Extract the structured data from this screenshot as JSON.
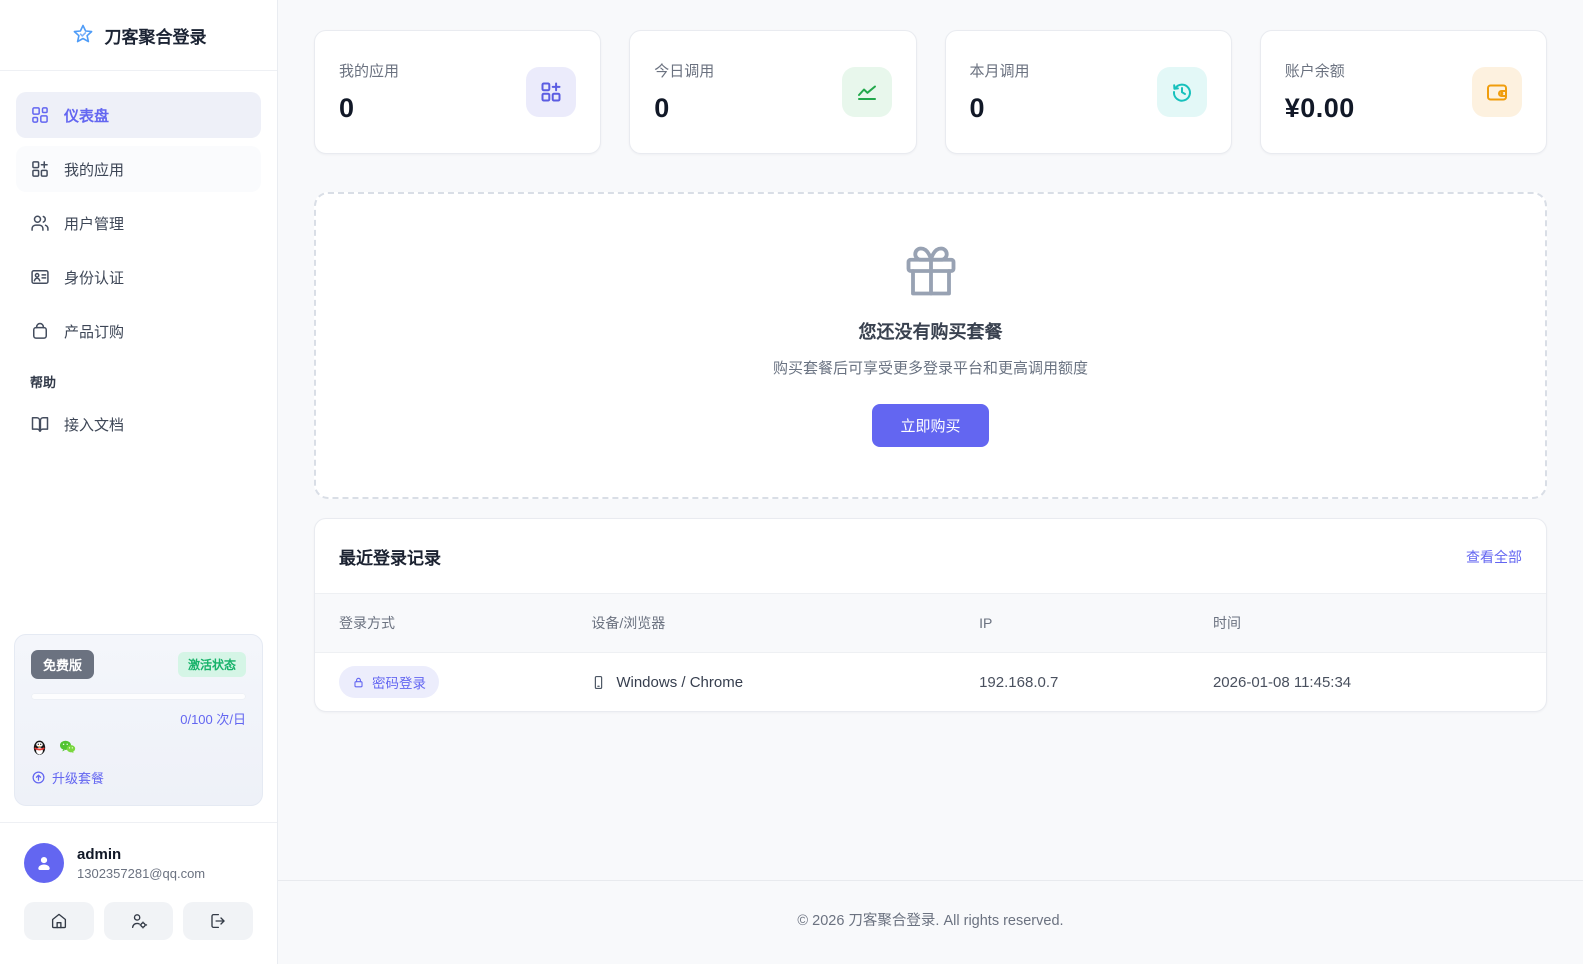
{
  "app": {
    "name": "刀客聚合登录",
    "footer": "© 2026 刀客聚合登录. All rights reserved."
  },
  "colors": {
    "accent": "#6366f1",
    "success": "#17b26a",
    "teal": "#17c1bc",
    "orange": "#f09d0c",
    "main_bg": "#f8f9fb"
  },
  "sidebar": {
    "items": [
      {
        "label": "仪表盘",
        "icon": "dashboard-grid-icon",
        "active": true
      },
      {
        "label": "我的应用",
        "icon": "grid-plus-icon"
      },
      {
        "label": "用户管理",
        "icon": "users-icon"
      },
      {
        "label": "身份认证",
        "icon": "id-card-icon"
      },
      {
        "label": "产品订购",
        "icon": "shopping-bag-icon"
      }
    ],
    "help_section": "帮助",
    "docs_item": {
      "label": "接入文档",
      "icon": "book-icon"
    },
    "plan": {
      "name": "免费版",
      "status": "激活状态",
      "quota": "0/100 次/日",
      "upgrade": "升级套餐",
      "platform_icons": [
        "qq-icon",
        "wechat-icon"
      ]
    },
    "user": {
      "name": "admin",
      "email": "1302357281@qq.com"
    }
  },
  "stats": [
    {
      "label": "我的应用",
      "value": "0",
      "icon": "grid-plus-icon",
      "color": "#5b5ce2",
      "bg": "#ebebfb"
    },
    {
      "label": "今日调用",
      "value": "0",
      "icon": "trend-chart-icon",
      "color": "#23a84c",
      "bg": "#e8f7ec"
    },
    {
      "label": "本月调用",
      "value": "0",
      "icon": "clock-history-icon",
      "color": "#17c1bc",
      "bg": "#e3f8f7"
    },
    {
      "label": "账户余额",
      "value": "¥0.00",
      "icon": "wallet-icon",
      "color": "#f09d0c",
      "bg": "#fdf1df"
    }
  ],
  "empty_state": {
    "icon": "gift-icon",
    "title": "您还没有购买套餐",
    "subtitle": "购买套餐后可享受更多登录平台和更高调用额度",
    "cta": "立即购买"
  },
  "recent_logins": {
    "title": "最近登录记录",
    "view_all": "查看全部",
    "columns": [
      "登录方式",
      "设备/浏览器",
      "IP",
      "时间"
    ],
    "rows": [
      {
        "method": "密码登录",
        "method_icon": "lock-icon",
        "device": "Windows / Chrome",
        "device_icon": "smartphone-icon",
        "ip": "192.168.0.7",
        "time": "2026-01-08 11:45:34"
      }
    ]
  }
}
